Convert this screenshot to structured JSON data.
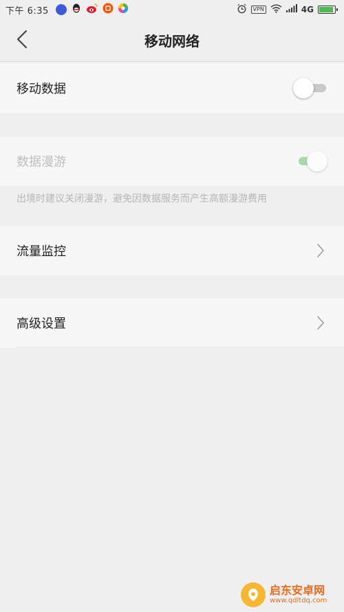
{
  "status_bar": {
    "time": "下午 6:35",
    "vpn": "VPN",
    "network": "4G",
    "battery_level": 0.9,
    "apps": [
      "shield-app",
      "qq-app",
      "weibo-app",
      "taobao-app",
      "color-app"
    ],
    "app_colors": [
      "#3d5bd9",
      "#222222",
      "#e6162d",
      "#ff5000",
      "#e04b9a"
    ]
  },
  "header": {
    "title": "移动网络",
    "back_icon": "chevron-left-icon"
  },
  "rows": {
    "mobile_data": {
      "label": "移动数据",
      "toggle": "off"
    },
    "data_roaming": {
      "label": "数据漫游",
      "toggle": "on",
      "enabled": false,
      "note": "出境时建议关闭漫游，避免因数据服务而产生高额漫游费用"
    },
    "traffic_monitor": {
      "label": "流量监控",
      "icon": "chevron-right-icon"
    },
    "advanced_settings": {
      "label": "高级设置",
      "icon": "chevron-right-icon"
    }
  },
  "watermark": {
    "title": "启东安卓网",
    "url": "www.qdltdq.com"
  },
  "colors": {
    "background": "#efefef",
    "row_background": "#f7f7f7",
    "toggle_on_track": "#a9d9ab",
    "battery": "#4cbb57"
  }
}
